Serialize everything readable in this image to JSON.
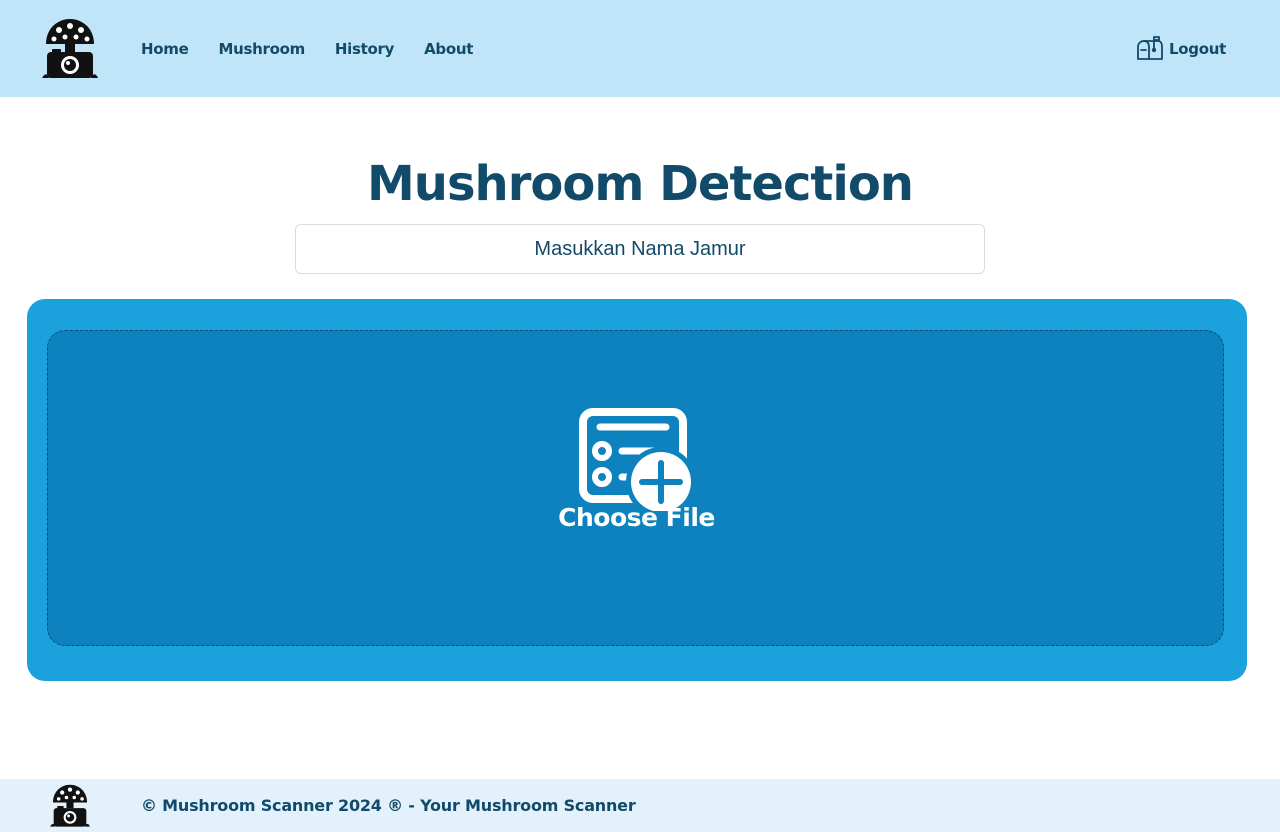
{
  "nav": {
    "links": [
      "Home",
      "Mushroom",
      "History",
      "About"
    ],
    "logout_label": "Logout",
    "logo_icon": "mushroom-camera-logo-icon",
    "logout_icon": "mailbox-icon"
  },
  "main": {
    "title": "Mushroom Detection",
    "name_input": {
      "placeholder": "Masukkan Nama Jamur",
      "value": ""
    },
    "upload": {
      "label": "Choose File",
      "icon": "file-add-icon"
    }
  },
  "footer": {
    "text": "© Mushroom Scanner 2024 ® - Your Mushroom Scanner",
    "logo_icon": "mushroom-camera-logo-icon"
  },
  "colors": {
    "navbar_bg": "#c1e5f8",
    "primary_text": "#124a6a",
    "upload_card_bg": "#1ba1dc",
    "drop_zone_bg": "#0e82be",
    "footer_bg": "#e2f1fb"
  }
}
